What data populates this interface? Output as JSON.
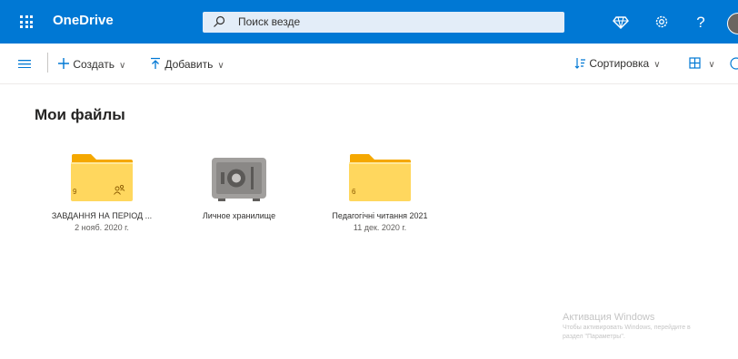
{
  "app": {
    "name": "OneDrive"
  },
  "search": {
    "placeholder": "Поиск везде"
  },
  "header_icons": [
    "waffle-icon",
    "premium-diamond-icon",
    "settings-gear-icon",
    "help-icon",
    "avatar"
  ],
  "toolbar": {
    "create_label": "Создать",
    "upload_label": "Добавить",
    "sort_label": "Сортировка"
  },
  "page": {
    "title": "Мои файлы"
  },
  "items": [
    {
      "type": "folder",
      "name": "ЗАВДАННЯ НА ПЕРІОД ...",
      "date": "2 нояб. 2020 г.",
      "count": "9",
      "shared": true
    },
    {
      "type": "vault",
      "name": "Личное хранилище"
    },
    {
      "type": "folder",
      "name": "Педагогічні читання 2021",
      "date": "11 дек. 2020 г.",
      "count": "6",
      "shared": false
    }
  ],
  "watermark": {
    "title": "Активация Windows",
    "line1": "Чтобы активировать Windows, перейдите в",
    "line2": "раздел \"Параметры\"."
  },
  "colors": {
    "brand": "#0078d4",
    "folder": "#ffd75e",
    "folder_tab": "#f5a800"
  }
}
